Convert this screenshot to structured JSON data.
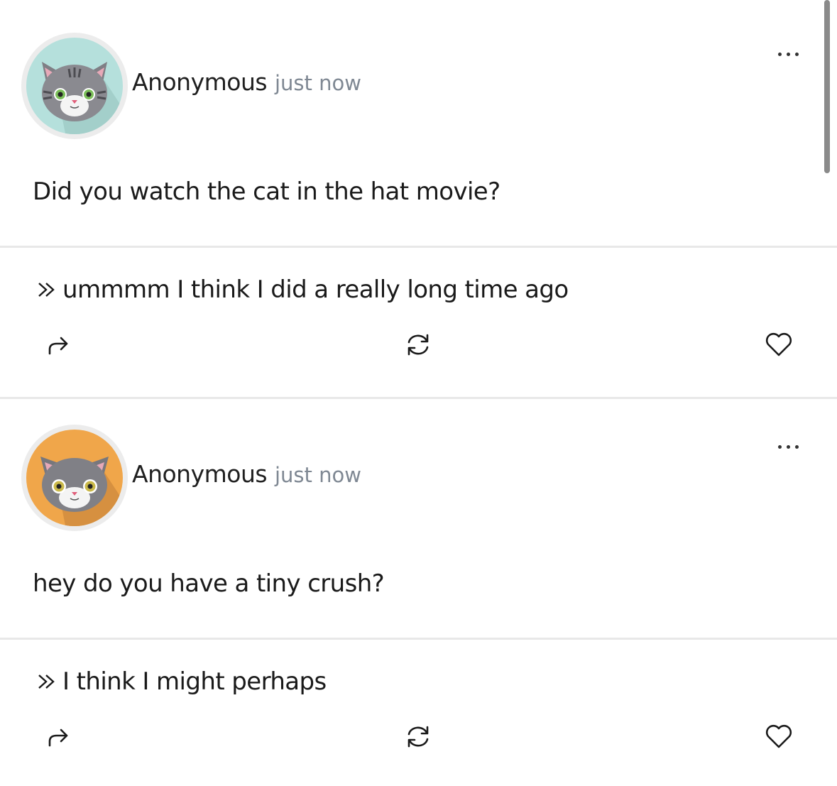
{
  "posts": [
    {
      "author": "Anonymous",
      "time": "just now",
      "question": "Did you watch the cat in the hat movie?",
      "answer": "ummmm I think I did a really long time ago",
      "avatar_color": "#b5e0dc",
      "avatar_icon": "gray-tabby-cat-icon"
    },
    {
      "author": "Anonymous",
      "time": "just now",
      "question": "hey do you have a tiny crush?",
      "answer": "I think I might perhaps",
      "avatar_color": "#f0a64a",
      "avatar_icon": "gray-cat-icon"
    }
  ],
  "icons": {
    "more": "more-dots-icon",
    "answer_prefix": "double-chevron-right-icon",
    "share": "share-arrow-icon",
    "refresh": "refresh-icon",
    "like": "heart-icon"
  }
}
